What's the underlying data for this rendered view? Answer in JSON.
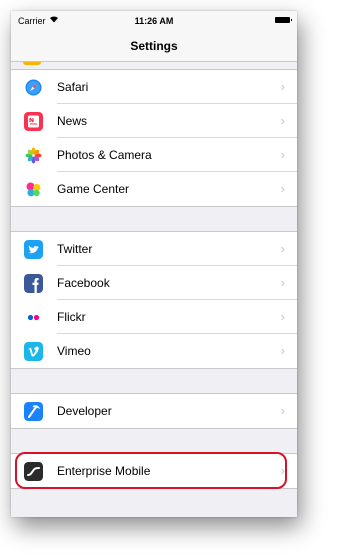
{
  "status_bar": {
    "carrier": "Carrier",
    "time": "11:26 AM"
  },
  "nav": {
    "title": "Settings"
  },
  "groups": [
    {
      "rows": [
        {
          "label": "Safari",
          "icon": "safari-icon"
        },
        {
          "label": "News",
          "icon": "news-icon"
        },
        {
          "label": "Photos & Camera",
          "icon": "photos-icon"
        },
        {
          "label": "Game Center",
          "icon": "game-center-icon"
        }
      ]
    },
    {
      "rows": [
        {
          "label": "Twitter",
          "icon": "twitter-icon"
        },
        {
          "label": "Facebook",
          "icon": "facebook-icon"
        },
        {
          "label": "Flickr",
          "icon": "flickr-icon"
        },
        {
          "label": "Vimeo",
          "icon": "vimeo-icon"
        }
      ]
    },
    {
      "rows": [
        {
          "label": "Developer",
          "icon": "developer-icon"
        }
      ]
    },
    {
      "rows": [
        {
          "label": "Enterprise Mobile",
          "icon": "enterprise-mobile-icon"
        }
      ]
    }
  ],
  "colors": {
    "highlight": "#d8102a",
    "background": "#efeff4",
    "twitter": "#1da1f2",
    "facebook": "#3b5998",
    "vimeo": "#1ab7ea",
    "developer": "#1a82fb"
  }
}
